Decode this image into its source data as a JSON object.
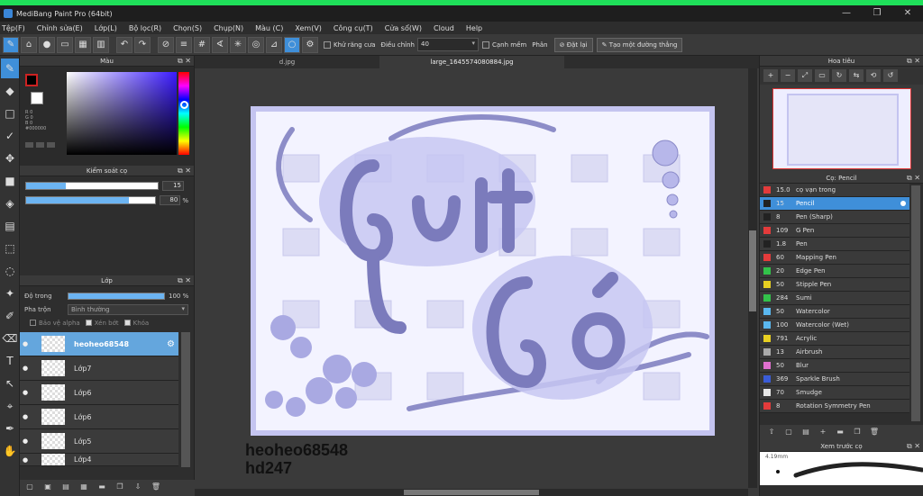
{
  "window": {
    "title": "MediBang Paint Pro (64bit)",
    "controls": [
      "—",
      "❐",
      "✕"
    ]
  },
  "menu": [
    "Tệp(F)",
    "Chỉnh sửa(E)",
    "Lớp(L)",
    "Bộ lọc(R)",
    "Chọn(S)",
    "Chụp(N)",
    "Màu (C)",
    "Xem(V)",
    "Công cụ(T)",
    "Cửa sổ(W)",
    "Cloud",
    "Help"
  ],
  "toolbar": {
    "antialias_label": "Khử răng cưa",
    "adjust_label": "Điều chỉnh",
    "adjust_value": "40",
    "snap_edge_label": "Cạnh mềm",
    "split_label": "Phân",
    "cancel_label": "Đặt lại",
    "create_straight_label": "Tạo một đường thẳng"
  },
  "color_panel": {
    "title": "Màu",
    "info": [
      "R 0",
      "G 0",
      "B 0",
      "#000000"
    ],
    "fg": "#000000",
    "bg": "#ffffff"
  },
  "brush_control": {
    "title": "Kiểm soát cọ",
    "size": "15",
    "size_fill": 0.3,
    "opacity": "80",
    "opacity_fill": 0.8,
    "pct": "%"
  },
  "layers_panel": {
    "title": "Lớp",
    "opacity_label": "Độ trong",
    "opacity_value": "100",
    "pct": "%",
    "blend_label": "Pha trộn",
    "blend_value": "Bình thường",
    "protect_alpha": "Bảo vệ alpha",
    "clipping": "Xén bớt",
    "lock": "Khóa",
    "layers": [
      {
        "name": "heoheo68548",
        "selected": true
      },
      {
        "name": "Lớp7",
        "selected": false
      },
      {
        "name": "Lớp6",
        "selected": false
      },
      {
        "name": "Lớp6",
        "selected": false
      },
      {
        "name": "Lớp5",
        "selected": false
      },
      {
        "name": "Lớp4",
        "selected": false
      }
    ]
  },
  "canvas": {
    "tabs": [
      "d.jpg",
      "large_1645574080884.jpg"
    ],
    "watermark_line1": "heoheo68548",
    "watermark_line2": "hd247"
  },
  "navigator": {
    "title": "Hoa tiêu"
  },
  "brush_panel": {
    "title": "Cọ: Pencil",
    "brushes": [
      {
        "size": "15.0",
        "name": "cọ vạn trong",
        "color": "#e43b3b"
      },
      {
        "size": "15",
        "name": "Pencil",
        "color": "#222222",
        "selected": true
      },
      {
        "size": "8",
        "name": "Pen (Sharp)",
        "color": "#222222"
      },
      {
        "size": "109",
        "name": "G Pen",
        "color": "#e43b3b"
      },
      {
        "size": "1.8",
        "name": "Pen",
        "color": "#222222"
      },
      {
        "size": "60",
        "name": "Mapping Pen",
        "color": "#e43b3b"
      },
      {
        "size": "20",
        "name": "Edge Pen",
        "color": "#32c24a"
      },
      {
        "size": "50",
        "name": "Stipple Pen",
        "color": "#e8d021"
      },
      {
        "size": "284",
        "name": "Sumi",
        "color": "#32c24a"
      },
      {
        "size": "50",
        "name": "Watercolor",
        "color": "#5ab8f0"
      },
      {
        "size": "100",
        "name": "Watercolor (Wet)",
        "color": "#5ab8f0"
      },
      {
        "size": "791",
        "name": "Acrylic",
        "color": "#e8d021"
      },
      {
        "size": "13",
        "name": "Airbrush",
        "color": "#aaaaaa"
      },
      {
        "size": "50",
        "name": "Blur",
        "color": "#e070d0"
      },
      {
        "size": "369",
        "name": "Sparkle Brush",
        "color": "#3a5cd8"
      },
      {
        "size": "70",
        "name": "Smudge",
        "color": "#e8e8e8"
      },
      {
        "size": "8",
        "name": "Rotation Symmetry Pen",
        "color": "#e43b3b"
      }
    ]
  },
  "preview_panel": {
    "title": "Xem trước cọ",
    "size_label": "4.19mm"
  },
  "icons": {
    "tools": [
      "pencil-icon",
      "eraser-icon",
      "rect-select-icon",
      "check-icon",
      "move-icon",
      "fill-rect-icon",
      "bucket-icon",
      "gradient-icon",
      "select-icon",
      "lasso-icon",
      "wand-icon",
      "select-pen-icon",
      "select-eraser-icon",
      "text-icon",
      "operation-icon",
      "eyedropper-icon",
      "pen-icon",
      "hand-icon"
    ]
  }
}
